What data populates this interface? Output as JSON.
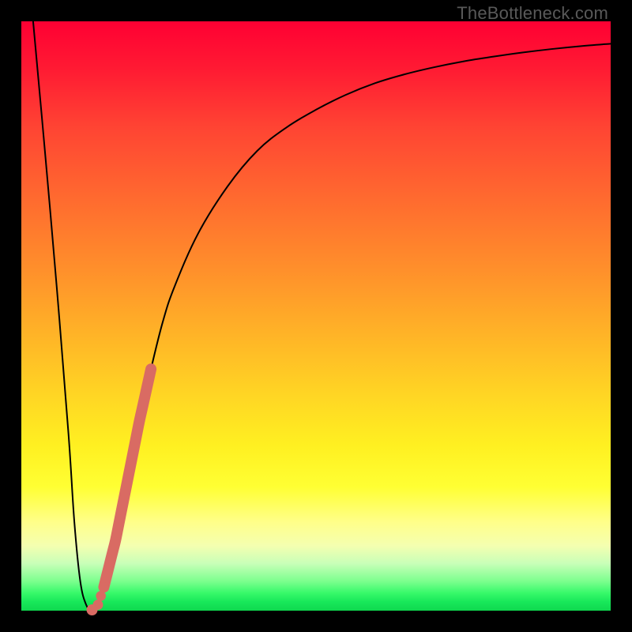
{
  "watermark": "TheBottleneck.com",
  "chart_data": {
    "type": "line",
    "title": "",
    "xlabel": "",
    "ylabel": "",
    "xlim": [
      0,
      100
    ],
    "ylim": [
      0,
      100
    ],
    "grid": false,
    "legend": false,
    "series": [
      {
        "name": "bottleneck-curve",
        "x": [
          2,
          4,
          6,
          8,
          9,
          10,
          11,
          12,
          13,
          14,
          16,
          18,
          20,
          22,
          24,
          26,
          30,
          35,
          40,
          45,
          50,
          55,
          60,
          65,
          70,
          75,
          80,
          85,
          90,
          95,
          100
        ],
        "y": [
          100,
          78,
          55,
          30,
          15,
          5,
          1,
          0,
          1,
          4,
          12,
          22,
          32,
          41,
          49,
          55,
          64,
          72,
          78,
          82,
          85,
          87.5,
          89.5,
          91,
          92.2,
          93.2,
          94,
          94.7,
          95.3,
          95.8,
          96.2
        ]
      }
    ],
    "highlight_segment": {
      "x_start": 14,
      "x_end": 22,
      "note": "salmon thick stroke along rising curve"
    },
    "highlight_points_x": [
      13,
      13.5,
      14
    ],
    "min_point": {
      "x": 12,
      "y": 0
    }
  }
}
